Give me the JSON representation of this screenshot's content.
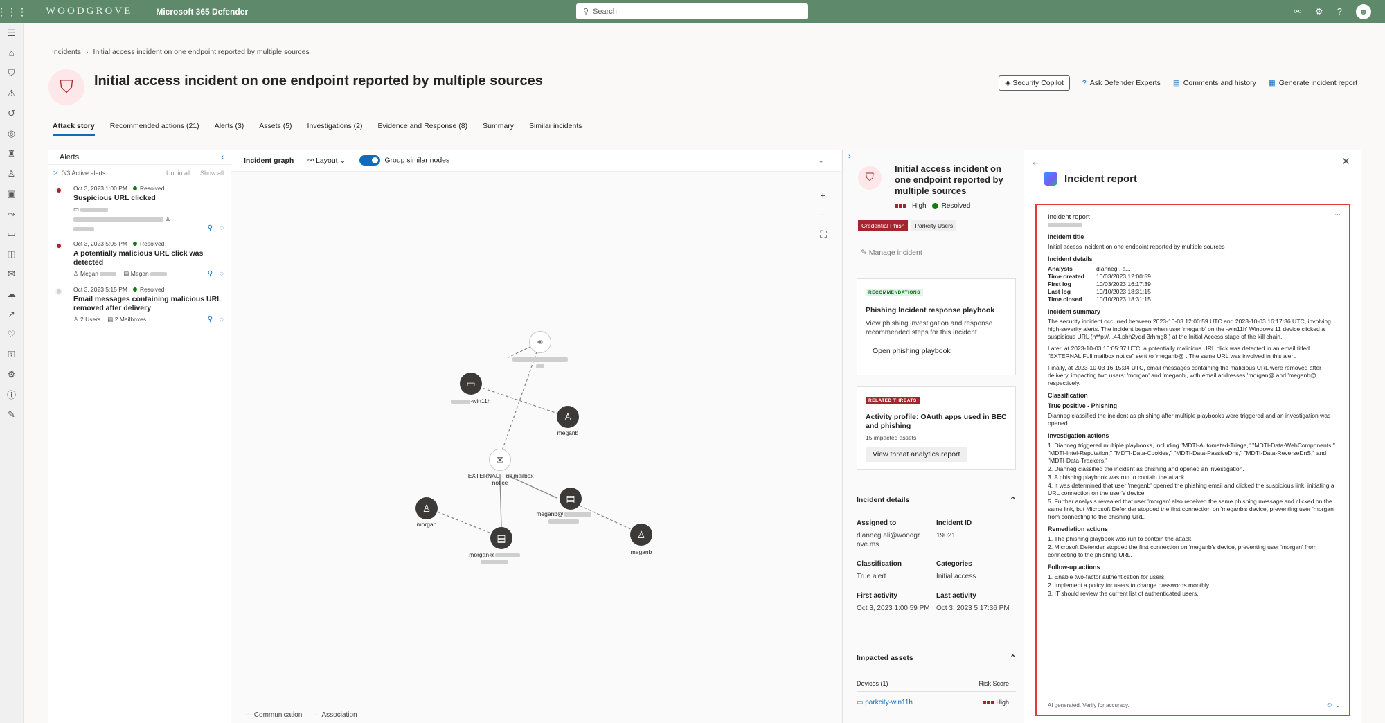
{
  "topbar": {
    "brand": "WOODGROVE",
    "product": "Microsoft 365 Defender",
    "search_placeholder": "Search"
  },
  "breadcrumb": {
    "root": "Incidents",
    "current": "Initial access incident on one endpoint reported by multiple sources"
  },
  "page": {
    "title": "Initial access incident on one endpoint reported by multiple sources"
  },
  "actions": {
    "copilot": "Security Copilot",
    "experts": "Ask Defender Experts",
    "comments": "Comments and history",
    "report": "Generate incident report"
  },
  "tabs": [
    "Attack story",
    "Recommended actions (21)",
    "Alerts (3)",
    "Assets (5)",
    "Investigations (2)",
    "Evidence and Response (8)",
    "Summary",
    "Similar incidents"
  ],
  "alerts_panel": {
    "title": "Alerts",
    "active": "0/3 Active alerts",
    "unpin": "Unpin all",
    "show": "Show all",
    "items": [
      {
        "time": "Oct 3, 2023 1:00 PM",
        "status": "Resolved",
        "name": "Suspicious URL clicked",
        "dot": "#a4262c",
        "entities": []
      },
      {
        "time": "Oct 3, 2023 5:05 PM",
        "status": "Resolved",
        "name": "A potentially malicious URL click was detected",
        "dot": "#a4262c",
        "entities": [
          "Megan",
          "Megan"
        ]
      },
      {
        "time": "Oct 3, 2023 5:15 PM",
        "status": "Resolved",
        "name": "Email messages containing malicious URL removed after delivery",
        "dot": "#d1d1d1",
        "entities": [
          "2 Users",
          "2 Mailboxes"
        ]
      }
    ]
  },
  "graph": {
    "title": "Incident graph",
    "layout": "Layout",
    "group": "Group similar nodes",
    "legend_comm": "Communication",
    "legend_assoc": "Association",
    "labels": {
      "win11": "-win11h",
      "meganb1": "meganb",
      "email": "[EXTERNAL] Full mailbox notice",
      "meganb_mail": "meganb@",
      "morgan": "morgan",
      "morgan_mail": "morgan@",
      "meganb2": "meganb"
    }
  },
  "summary": {
    "title": "Initial access incident on one endpoint reported by multiple sources",
    "severity": "High",
    "status": "Resolved",
    "tags": [
      "Credential Phish",
      "Parkcity Users"
    ],
    "manage": "Manage incident",
    "rec_badge": "RECOMMENDATIONS",
    "rec_title": "Phishing Incident response playbook",
    "rec_text": "View phishing investigation and response recommended steps for this incident",
    "rec_btn": "Open phishing playbook",
    "thr_badge": "RELATED THREATS",
    "thr_title": "Activity profile: OAuth apps used in BEC and phishing",
    "thr_sub": "15 impacted assets",
    "thr_btn": "View threat analytics report",
    "details_title": "Incident details",
    "assigned_label": "Assigned to",
    "assigned": "dianneg ali@woodgr ove.ms",
    "id_label": "Incident ID",
    "id": "19021",
    "class_label": "Classification",
    "class": "True alert",
    "cat_label": "Categories",
    "cat": "Initial access",
    "first_label": "First activity",
    "first": "Oct 3, 2023 1:00:59 PM",
    "last_label": "Last activity",
    "last": "Oct 3, 2023 5:17:36 PM",
    "assets_title": "Impacted assets",
    "devices": "Devices (1)",
    "risk": "Risk Score",
    "device": "parkcity-win11h",
    "device_risk": "High"
  },
  "report": {
    "panel_title": "Incident report",
    "box_title": "Incident report",
    "h_title": "Incident title",
    "title_text": "Initial access incident on one endpoint reported by multiple sources",
    "h_details": "Incident details",
    "kv": [
      [
        "Analysts",
        "dianneg , a..."
      ],
      [
        "Time created",
        "10/03/2023 12:00:59"
      ],
      [
        "First log",
        "10/03/2023 16:17:39"
      ],
      [
        "Last log",
        "10/10/2023 18:31:15"
      ],
      [
        "Time closed",
        "10/10/2023 18:31:15"
      ]
    ],
    "h_summary": "Incident summary",
    "p1": "The security incident occurred between 2023-10-03 12:00:59 UTC and 2023-10-03 16:17:36 UTC, involving high-severity alerts. The incident began when user 'meganb' on the -win11h' Windows 11 device clicked a suspicious URL (h**p://...44.phh2yqd-3rhmg8.) at the Initial Access stage of the kill chain.",
    "p2": "Later, at 2023-10-03 16:05:37 UTC, a potentially malicious URL click was detected in an email titled \"EXTERNAL Full mailbox notice\" sent to 'meganb@ . The same URL was involved in this alert.",
    "p3": "Finally, at 2023-10-03 16:15:34 UTC, email messages containing the malicious URL were removed after delivery, impacting two users: 'morgan' and 'meganb', with email addresses 'morgan@ and 'meganb@ respectively.",
    "h_class": "Classification",
    "class_val": "True positive - Phishing",
    "class_text": "Dianneg classified the incident as phishing after multiple playbooks were triggered and an investigation was opened.",
    "h_inv": "Investigation actions",
    "inv": [
      "1. Dianneg triggered multiple playbooks, including \"MDTI-Automated-Triage,\" \"MDTI-Data-WebComponents,\" \"MDTI-Intel-Reputation,\" \"MDTI-Data-Cookies,\" \"MDTI-Data-PassiveDns,\" \"MDTI-Data-ReverseDnS,\" and \"MDTI-Data-Trackers.\"",
      "2. Dianneg classified the incident as phishing and opened an investigation.",
      "3. A phishing playbook was run to contain the attack.",
      "4. It was determined that user 'meganb' opened the phishing email and clicked the suspicious link, initiating a URL connection on the user's device.",
      "5. Further analysis revealed that user 'morgan' also received the same phishing message and clicked on the same link, but Microsoft Defender stopped the first connection on 'meganb's device, preventing user 'morgan' from connecting to the phishing URL."
    ],
    "h_rem": "Remediation actions",
    "rem": [
      "1. The phishing playbook was run to contain the attack.",
      "2. Microsoft Defender stopped the first connection on 'meganb's device, preventing user 'morgan' from connecting to the phishing URL."
    ],
    "h_fu": "Follow-up actions",
    "fu": [
      "1. Enable two-factor authentication for users.",
      "2. Implement a policy for users to change passwords monthly.",
      "3. IT should review the current list of authenticated users."
    ],
    "footer": "AI generated. Verify for accuracy."
  }
}
